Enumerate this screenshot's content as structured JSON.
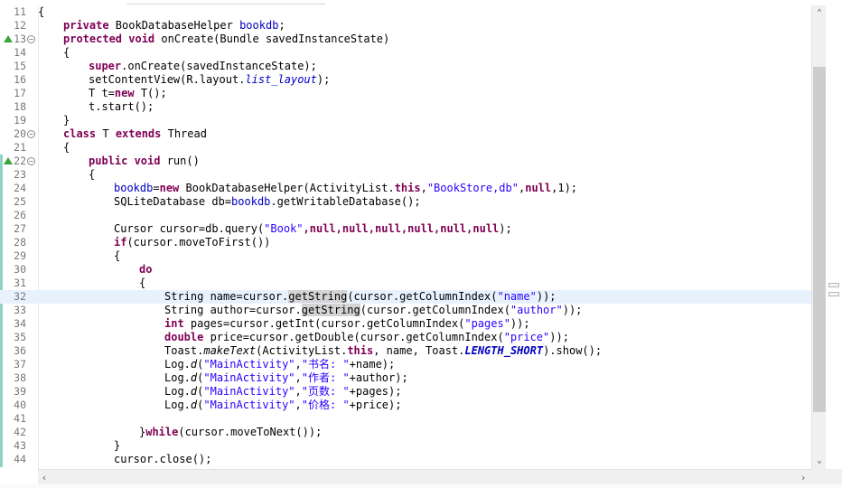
{
  "editor": {
    "line_numbers": [
      "11",
      "12",
      "13",
      "14",
      "15",
      "16",
      "17",
      "18",
      "19",
      "20",
      "21",
      "22",
      "23",
      "24",
      "25",
      "26",
      "27",
      "28",
      "29",
      "30",
      "31",
      "32",
      "33",
      "34",
      "35",
      "36",
      "37",
      "38",
      "39",
      "40",
      "41",
      "42",
      "43",
      "44"
    ],
    "current_line": "32"
  },
  "code": {
    "l11": "{",
    "l12_kw": "private ",
    "l12_type": "BookDatabaseHelper ",
    "l12_field": "bookdb",
    "l12_end": ";",
    "l13_kw1": "protected ",
    "l13_kw2": "void ",
    "l13_rest": "onCreate(Bundle savedInstanceState)",
    "l14": "{",
    "l15_kw": "super",
    "l15_rest": ".onCreate(savedInstanceState);",
    "l16_a": "setContentView(R.layout.",
    "l16_field": "list_layout",
    "l16_b": ");",
    "l17_a": "T t=",
    "l17_kw": "new ",
    "l17_b": "T();",
    "l18": "t.start();",
    "l19": "}",
    "l20_kw1": "class ",
    "l20_a": "T ",
    "l20_kw2": "extends ",
    "l20_b": "Thread",
    "l21": "{",
    "l22_kw1": "public ",
    "l22_kw2": "void ",
    "l22_rest": "run()",
    "l23": "{",
    "l24_field": "bookdb",
    "l24_a": "=",
    "l24_kw1": "new ",
    "l24_b": "BookDatabaseHelper(ActivityList.",
    "l24_kw2": "this",
    "l24_c": ",",
    "l24_str": "\"BookStore,db\"",
    "l24_d": ",",
    "l24_kw3": "null",
    "l24_e": ",1);",
    "l25_a": "SQLiteDatabase db=",
    "l25_field": "bookdb",
    "l25_b": ".getWritableDatabase();",
    "l26": "",
    "l27_a": "Cursor cursor=db.query(",
    "l27_str": "\"Book\"",
    "l27_nulls": ",null,null,null,null,null,null",
    "l27_b": ");",
    "l28_kw": "if",
    "l28_rest": "(cursor.moveToFirst())",
    "l29": "{",
    "l30_kw": "do",
    "l31": "{",
    "l32_a": "String name=cursor.",
    "l32_occ": "getString",
    "l32_b": "(cursor.getColumnIndex(",
    "l32_str": "\"name\"",
    "l32_c": "));",
    "l33_a": "String author=cursor.",
    "l33_occ": "getString",
    "l33_b": "(cursor.getColumnIndex(",
    "l33_str": "\"author\"",
    "l33_c": "));",
    "l34_kw": "int ",
    "l34_a": "pages=cursor.getInt(cursor.getColumnIndex(",
    "l34_str": "\"pages\"",
    "l34_b": "));",
    "l35_kw": "double ",
    "l35_a": "price=cursor.getDouble(cursor.getColumnIndex(",
    "l35_str": "\"price\"",
    "l35_b": "));",
    "l36_a": "Toast.",
    "l36_it": "makeText",
    "l36_b": "(ActivityList.",
    "l36_kw": "this",
    "l36_c": ", name, Toast.",
    "l36_sf": "LENGTH_SHORT",
    "l36_d": ").show();",
    "l37_a": "Log.",
    "l37_it": "d",
    "l37_b": "(",
    "l37_str1": "\"MainActivity\"",
    "l37_c": ",",
    "l37_str2": "\"书名: \"",
    "l37_d": "+name);",
    "l38_a": "Log.",
    "l38_it": "d",
    "l38_b": "(",
    "l38_str1": "\"MainActivity\"",
    "l38_c": ",",
    "l38_str2": "\"作者: \"",
    "l38_d": "+author);",
    "l39_a": "Log.",
    "l39_it": "d",
    "l39_b": "(",
    "l39_str1": "\"MainActivity\"",
    "l39_c": ",",
    "l39_str2": "\"页数: \"",
    "l39_d": "+pages);",
    "l40_a": "Log.",
    "l40_it": "d",
    "l40_b": "(",
    "l40_str1": "\"MainActivity\"",
    "l40_c": ",",
    "l40_str2": "\"价格: \"",
    "l40_d": "+price);",
    "l41": "",
    "l42_a": "}",
    "l42_kw": "while",
    "l42_b": "(cursor.moveToNext());",
    "l43": "}",
    "l44": "cursor.close();"
  },
  "scroll": {
    "up_arrow": "⌃",
    "down_arrow": "⌄",
    "left_arrow": "‹",
    "right_arrow": "›"
  },
  "colors": {
    "keyword": "#7f0055",
    "field": "#0000c0",
    "string": "#2a00ff",
    "current_line": "#e8f2fe",
    "change_bar": "#8fd3c4"
  },
  "icons": {
    "override_marker": "green-triangle-up",
    "fold": "minus-circle"
  }
}
